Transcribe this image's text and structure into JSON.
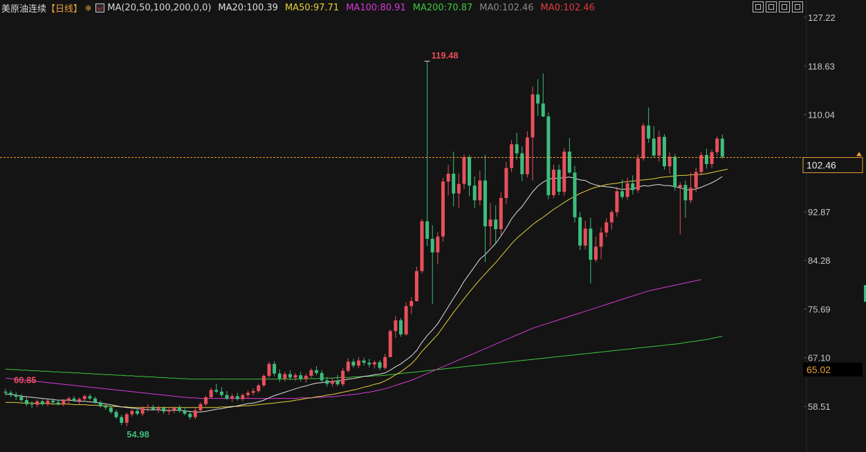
{
  "header": {
    "title": "美原油连续",
    "period": "【日线】",
    "settings_icon": "crosshair-settings-icon",
    "ma_icon": "indicator-settings-icon",
    "ma_param": "MA(20,50,100,200,0,0)",
    "ma_values": [
      {
        "label": "MA20:100.39",
        "color": "#e0e0e0"
      },
      {
        "label": "MA50:97.71",
        "color": "#e6d23c"
      },
      {
        "label": "MA100:80.91",
        "color": "#d83ad8"
      },
      {
        "label": "MA200:70.87",
        "color": "#3cc83c"
      },
      {
        "label": "MA0:102.46",
        "color": "#8a8a8a"
      },
      {
        "label": "MA0:102.46",
        "color": "#e23c3c"
      }
    ]
  },
  "toolbar": {
    "icons": [
      "layout-grid-icon",
      "layout-split-icon",
      "layout-panel-icon",
      "play-icon"
    ]
  },
  "colors": {
    "background": "#141414",
    "up": "#e8505b",
    "down": "#3dbd7d",
    "ma20": "#e0e0e0",
    "ma50": "#e6d23c",
    "ma100": "#d83ad8",
    "ma200": "#3cc83c",
    "axis_text": "#c8c8c8",
    "last_price_line": "#f0a030"
  },
  "chart_data": {
    "type": "candlestick",
    "y_axis": {
      "side": "right",
      "ticks": [
        "127.22",
        "118.63",
        "110.04",
        "92.87",
        "84.28",
        "75.69",
        "67.10",
        "58.51"
      ],
      "range": [
        52.0,
        127.22
      ]
    },
    "annotations": {
      "high": "119.48",
      "low": "54.98",
      "left_price": "60.85"
    },
    "current_price": {
      "value": 102.46,
      "label": "102.46"
    },
    "marker_price": {
      "value": 65.02,
      "label": "65.02"
    },
    "candles": [
      [
        61.1,
        61.6,
        60.4,
        60.9
      ],
      [
        60.9,
        61.3,
        60.1,
        60.5
      ],
      [
        60.5,
        61.0,
        59.6,
        60.2
      ],
      [
        60.2,
        60.7,
        59.3,
        59.6
      ],
      [
        59.6,
        60.1,
        58.5,
        58.9
      ],
      [
        58.9,
        59.4,
        58.2,
        58.8
      ],
      [
        58.8,
        59.7,
        58.4,
        59.4
      ],
      [
        59.4,
        59.8,
        58.6,
        58.9
      ],
      [
        58.9,
        59.7,
        58.5,
        59.5
      ],
      [
        59.5,
        59.9,
        58.8,
        59.2
      ],
      [
        59.2,
        59.6,
        58.6,
        58.9
      ],
      [
        58.9,
        59.8,
        58.5,
        59.6
      ],
      [
        59.6,
        60.2,
        59.0,
        59.9
      ],
      [
        59.9,
        60.3,
        59.3,
        59.5
      ],
      [
        59.5,
        60.1,
        58.9,
        59.8
      ],
      [
        59.8,
        60.6,
        59.5,
        60.3
      ],
      [
        60.3,
        60.7,
        59.6,
        59.9
      ],
      [
        59.9,
        60.2,
        59.0,
        59.2
      ],
      [
        59.2,
        59.5,
        58.3,
        58.6
      ],
      [
        58.6,
        59.1,
        57.9,
        58.3
      ],
      [
        58.3,
        58.6,
        57.2,
        57.5
      ],
      [
        57.5,
        57.9,
        56.3,
        56.6
      ],
      [
        56.6,
        57.0,
        55.2,
        55.6
      ],
      [
        55.6,
        57.4,
        54.98,
        57.1
      ],
      [
        57.1,
        58.0,
        56.7,
        57.7
      ],
      [
        57.7,
        58.2,
        56.9,
        57.2
      ],
      [
        57.2,
        58.5,
        56.8,
        58.2
      ],
      [
        58.2,
        58.9,
        57.6,
        58.4
      ],
      [
        58.4,
        58.8,
        57.7,
        58.0
      ],
      [
        58.0,
        58.6,
        57.3,
        58.2
      ],
      [
        58.2,
        58.5,
        57.2,
        57.6
      ],
      [
        57.6,
        58.2,
        57.0,
        57.9
      ],
      [
        57.9,
        58.5,
        57.3,
        58.3
      ],
      [
        58.3,
        58.7,
        57.4,
        57.7
      ],
      [
        57.7,
        58.3,
        56.9,
        57.2
      ],
      [
        57.2,
        57.6,
        56.2,
        56.6
      ],
      [
        56.6,
        58.2,
        56.2,
        57.8
      ],
      [
        57.8,
        59.2,
        57.5,
        58.9
      ],
      [
        58.9,
        60.4,
        58.6,
        60.1
      ],
      [
        60.1,
        61.8,
        59.9,
        61.4
      ],
      [
        61.4,
        62.5,
        60.8,
        61.1
      ],
      [
        61.1,
        61.9,
        60.1,
        60.5
      ],
      [
        60.5,
        61.2,
        59.6,
        59.9
      ],
      [
        59.9,
        60.7,
        59.3,
        60.3
      ],
      [
        60.3,
        60.9,
        59.5,
        59.8
      ],
      [
        59.8,
        60.8,
        59.4,
        60.5
      ],
      [
        60.5,
        61.3,
        60.0,
        60.9
      ],
      [
        60.9,
        61.7,
        60.4,
        61.2
      ],
      [
        61.2,
        62.5,
        60.9,
        62.2
      ],
      [
        62.2,
        64.2,
        61.9,
        63.9
      ],
      [
        63.9,
        66.4,
        63.5,
        66.0
      ],
      [
        66.0,
        66.5,
        63.8,
        64.3
      ],
      [
        64.3,
        65.0,
        62.8,
        63.4
      ],
      [
        63.4,
        64.6,
        62.9,
        64.2
      ],
      [
        64.2,
        64.9,
        63.1,
        63.6
      ],
      [
        63.6,
        64.4,
        63.0,
        64.0
      ],
      [
        64.0,
        64.6,
        62.9,
        63.3
      ],
      [
        63.3,
        64.3,
        62.7,
        63.9
      ],
      [
        63.9,
        65.2,
        63.6,
        64.9
      ],
      [
        64.9,
        65.6,
        64.0,
        64.4
      ],
      [
        64.4,
        64.9,
        62.7,
        63.1
      ],
      [
        63.1,
        63.7,
        62.0,
        62.5
      ],
      [
        62.5,
        63.4,
        62.0,
        63.0
      ],
      [
        63.0,
        64.1,
        62.1,
        62.4
      ],
      [
        62.4,
        65.3,
        62.0,
        64.8
      ],
      [
        64.8,
        67.0,
        64.5,
        66.4
      ],
      [
        66.4,
        66.9,
        65.3,
        65.7
      ],
      [
        65.7,
        67.2,
        65.2,
        66.6
      ],
      [
        66.6,
        67.1,
        65.7,
        66.2
      ],
      [
        66.2,
        66.9,
        65.4,
        65.9
      ],
      [
        65.9,
        66.6,
        65.2,
        66.3
      ],
      [
        66.3,
        66.7,
        64.9,
        65.3
      ],
      [
        65.3,
        67.8,
        65.0,
        67.2
      ],
      [
        67.2,
        72.1,
        69.1,
        71.8
      ],
      [
        71.8,
        74.5,
        70.6,
        73.7
      ],
      [
        73.7,
        74.1,
        70.8,
        71.2
      ],
      [
        71.2,
        76.9,
        71.0,
        76.2
      ],
      [
        76.2,
        77.8,
        74.8,
        77.1
      ],
      [
        77.1,
        83.2,
        77.0,
        82.4
      ],
      [
        82.4,
        91.6,
        82.0,
        91.2
      ],
      [
        91.2,
        119.48,
        86.8,
        88.1
      ],
      [
        88.1,
        90.5,
        76.6,
        85.7
      ],
      [
        85.7,
        89.3,
        83.6,
        88.5
      ],
      [
        88.5,
        98.9,
        87.6,
        98.2
      ],
      [
        98.2,
        101.2,
        95.7,
        99.6
      ],
      [
        99.6,
        103.5,
        93.8,
        96.1
      ],
      [
        96.1,
        99.6,
        93.6,
        97.8
      ],
      [
        97.8,
        103.0,
        96.9,
        102.5
      ],
      [
        102.5,
        102.9,
        95.6,
        97.5
      ],
      [
        97.5,
        99.1,
        93.5,
        94.9
      ],
      [
        94.9,
        100.1,
        94.0,
        98.4
      ],
      [
        98.4,
        102.9,
        84.0,
        90.3
      ],
      [
        90.3,
        94.4,
        86.8,
        91.5
      ],
      [
        91.5,
        94.0,
        87.3,
        89.8
      ],
      [
        89.8,
        96.3,
        88.8,
        95.3
      ],
      [
        95.3,
        101.7,
        94.2,
        100.6
      ],
      [
        100.6,
        105.5,
        99.9,
        104.8
      ],
      [
        104.8,
        106.8,
        102.1,
        103.2
      ],
      [
        103.2,
        104.4,
        98.3,
        99.5
      ],
      [
        99.5,
        107.1,
        98.9,
        106.0
      ],
      [
        106.0,
        115.0,
        98.4,
        113.6
      ],
      [
        113.6,
        116.3,
        109.8,
        112.0
      ],
      [
        112.0,
        117.3,
        109.6,
        109.7
      ],
      [
        109.7,
        110.4,
        95.1,
        95.8
      ],
      [
        95.8,
        101.2,
        95.3,
        100.3
      ],
      [
        100.3,
        101.2,
        95.8,
        96.4
      ],
      [
        96.4,
        104.1,
        95.7,
        103.5
      ],
      [
        103.5,
        105.9,
        99.6,
        99.8
      ],
      [
        99.8,
        101.0,
        91.0,
        91.9
      ],
      [
        91.9,
        92.8,
        86.1,
        86.9
      ],
      [
        86.9,
        91.3,
        86.2,
        89.9
      ],
      [
        89.9,
        91.8,
        80.2,
        84.4
      ],
      [
        84.4,
        88.5,
        84.0,
        86.7
      ],
      [
        86.7,
        90.1,
        84.5,
        89.2
      ],
      [
        89.2,
        91.7,
        88.4,
        91.0
      ],
      [
        91.0,
        93.2,
        89.7,
        92.8
      ],
      [
        92.8,
        97.3,
        92.0,
        96.5
      ],
      [
        96.5,
        98.6,
        95.1,
        95.5
      ],
      [
        95.5,
        98.9,
        95.0,
        97.9
      ],
      [
        97.9,
        99.3,
        95.9,
        96.7
      ],
      [
        96.7,
        103.0,
        96.2,
        102.3
      ],
      [
        102.3,
        108.5,
        101.9,
        108.1
      ],
      [
        108.1,
        111.3,
        105.1,
        105.8
      ],
      [
        105.8,
        108.0,
        102.5,
        102.8
      ],
      [
        102.8,
        107.2,
        101.7,
        106.1
      ],
      [
        106.1,
        106.6,
        100.3,
        100.9
      ],
      [
        100.9,
        103.4,
        99.6,
        102.6
      ],
      [
        102.6,
        103.1,
        96.6,
        97.2
      ],
      [
        97.2,
        98.1,
        88.9,
        97.6
      ],
      [
        97.6,
        98.4,
        91.8,
        94.9
      ],
      [
        94.9,
        99.8,
        94.4,
        97.1
      ],
      [
        97.1,
        100.7,
        96.3,
        99.9
      ],
      [
        99.9,
        103.5,
        99.3,
        102.9
      ],
      [
        102.9,
        104.0,
        100.5,
        101.3
      ],
      [
        101.3,
        103.9,
        100.6,
        103.4
      ],
      [
        103.4,
        106.2,
        102.8,
        105.8
      ],
      [
        105.8,
        106.5,
        102.2,
        102.6
      ]
    ],
    "ma20": [
      60.7,
      60.6,
      60.5,
      60.3,
      60.2,
      60.1,
      60.0,
      59.9,
      59.8,
      59.7,
      59.6,
      59.6,
      59.6,
      59.5,
      59.4,
      59.4,
      59.3,
      59.2,
      59.1,
      58.9,
      58.8,
      58.6,
      58.4,
      58.3,
      58.2,
      58.1,
      58.0,
      57.9,
      57.9,
      57.9,
      57.8,
      57.8,
      57.8,
      57.8,
      57.7,
      57.6,
      57.5,
      57.5,
      57.6,
      57.8,
      58.0,
      58.1,
      58.3,
      58.4,
      58.6,
      58.8,
      59.0,
      59.1,
      59.3,
      59.6,
      60.0,
      60.4,
      60.7,
      61.0,
      61.3,
      61.6,
      61.9,
      62.1,
      62.4,
      62.6,
      62.7,
      62.8,
      62.9,
      63.0,
      63.1,
      63.3,
      63.4,
      63.6,
      63.8,
      63.9,
      64.1,
      64.2,
      64.4,
      64.9,
      65.5,
      66.0,
      66.7,
      67.4,
      68.4,
      69.8,
      71.0,
      72.0,
      73.1,
      74.6,
      76.1,
      77.6,
      79.0,
      80.6,
      81.9,
      83.2,
      84.5,
      85.3,
      86.3,
      87.3,
      88.6,
      90.0,
      91.6,
      92.8,
      93.8,
      95.1,
      96.4,
      97.4,
      98.1,
      98.6,
      98.8,
      98.8,
      98.9,
      99.0,
      98.8,
      98.5,
      98.4,
      97.9,
      97.6,
      97.4,
      97.3,
      97.2,
      97.0,
      96.8,
      96.9,
      96.9,
      97.2,
      97.5,
      97.4,
      97.6,
      97.7,
      97.5,
      97.5,
      97.3,
      97.1,
      96.8,
      96.7,
      96.9,
      97.2,
      97.6,
      98.0,
      98.5,
      99.1
    ],
    "ma50": [
      59.2,
      59.2,
      59.2,
      59.1,
      59.1,
      59.1,
      59.0,
      59.0,
      59.0,
      58.9,
      58.9,
      58.9,
      58.9,
      58.8,
      58.8,
      58.8,
      58.7,
      58.7,
      58.6,
      58.6,
      58.5,
      58.5,
      58.4,
      58.4,
      58.3,
      58.3,
      58.3,
      58.3,
      58.3,
      58.3,
      58.3,
      58.3,
      58.3,
      58.3,
      58.3,
      58.3,
      58.3,
      58.3,
      58.3,
      58.3,
      58.3,
      58.4,
      58.4,
      58.5,
      58.5,
      58.6,
      58.6,
      58.7,
      58.8,
      58.9,
      59.0,
      59.1,
      59.2,
      59.3,
      59.4,
      59.6,
      59.7,
      59.9,
      60.0,
      60.2,
      60.3,
      60.5,
      60.6,
      60.8,
      61.0,
      61.2,
      61.4,
      61.6,
      61.9,
      62.1,
      62.4,
      62.6,
      63.0,
      63.5,
      64.1,
      64.6,
      65.3,
      66.0,
      67.0,
      68.2,
      69.2,
      70.2,
      71.2,
      72.5,
      73.8,
      75.1,
      76.3,
      77.5,
      78.7,
      79.8,
      80.9,
      81.9,
      82.9,
      83.9,
      85.0,
      86.1,
      87.2,
      88.2,
      89.0,
      89.8,
      90.6,
      91.3,
      91.9,
      92.6,
      93.3,
      93.9,
      94.5,
      95.1,
      95.6,
      96.1,
      96.5,
      96.9,
      97.2,
      97.4,
      97.7,
      97.8,
      97.9,
      98.1,
      98.2,
      98.3,
      98.4,
      98.5,
      98.6,
      98.7,
      98.9,
      99.0,
      99.1,
      99.2,
      99.3,
      99.3,
      99.4,
      99.4,
      99.5,
      99.6,
      99.8,
      100.0,
      100.2,
      100.4
    ],
    "ma100": [
      63.5,
      63.4,
      63.3,
      63.2,
      63.1,
      63.0,
      62.9,
      62.8,
      62.7,
      62.6,
      62.5,
      62.4,
      62.3,
      62.2,
      62.1,
      62.0,
      61.9,
      61.8,
      61.7,
      61.6,
      61.5,
      61.4,
      61.3,
      61.2,
      61.1,
      61.0,
      60.9,
      60.8,
      60.7,
      60.6,
      60.5,
      60.4,
      60.3,
      60.2,
      60.1,
      60.0,
      60.0,
      59.9,
      59.9,
      59.9,
      59.9,
      59.9,
      59.9,
      59.9,
      59.9,
      59.9,
      59.9,
      59.9,
      59.9,
      59.9,
      59.9,
      59.9,
      59.9,
      59.9,
      59.9,
      59.9,
      60.0,
      60.0,
      60.0,
      60.1,
      60.1,
      60.2,
      60.2,
      60.3,
      60.4,
      60.5,
      60.6,
      60.7,
      60.9,
      61.0,
      61.2,
      61.4,
      61.6,
      61.9,
      62.2,
      62.5,
      62.8,
      63.1,
      63.5,
      63.9,
      64.3,
      64.7,
      65.1,
      65.5,
      65.9,
      66.3,
      66.7,
      67.1,
      67.5,
      67.9,
      68.3,
      68.7,
      69.1,
      69.5,
      69.9,
      70.3,
      70.7,
      71.1,
      71.5,
      71.9,
      72.3,
      72.6,
      72.9,
      73.2,
      73.5,
      73.8,
      74.1,
      74.4,
      74.7,
      75.0,
      75.3,
      75.6,
      75.9,
      76.2,
      76.5,
      76.8,
      77.1,
      77.4,
      77.7,
      78.0,
      78.3,
      78.6,
      78.9,
      79.1,
      79.3,
      79.5,
      79.7,
      79.9,
      80.1,
      80.3,
      80.5,
      80.7,
      80.9
    ],
    "ma200": [
      65.1,
      65.0,
      65.0,
      64.9,
      64.9,
      64.8,
      64.8,
      64.7,
      64.7,
      64.6,
      64.6,
      64.5,
      64.5,
      64.4,
      64.4,
      64.3,
      64.3,
      64.2,
      64.2,
      64.1,
      64.1,
      64.0,
      64.0,
      63.9,
      63.9,
      63.8,
      63.8,
      63.7,
      63.7,
      63.6,
      63.6,
      63.5,
      63.5,
      63.4,
      63.4,
      63.3,
      63.3,
      63.3,
      63.3,
      63.3,
      63.3,
      63.3,
      63.3,
      63.3,
      63.3,
      63.3,
      63.3,
      63.3,
      63.3,
      63.3,
      63.3,
      63.3,
      63.3,
      63.3,
      63.3,
      63.3,
      63.4,
      63.4,
      63.4,
      63.4,
      63.5,
      63.5,
      63.5,
      63.6,
      63.6,
      63.6,
      63.7,
      63.7,
      63.8,
      63.8,
      63.9,
      63.9,
      64.0,
      64.1,
      64.2,
      64.3,
      64.4,
      64.5,
      64.6,
      64.7,
      64.8,
      64.9,
      65.0,
      65.1,
      65.2,
      65.3,
      65.4,
      65.5,
      65.6,
      65.7,
      65.8,
      65.9,
      66.0,
      66.1,
      66.2,
      66.3,
      66.4,
      66.5,
      66.6,
      66.7,
      66.8,
      66.9,
      67.0,
      67.1,
      67.2,
      67.3,
      67.4,
      67.5,
      67.6,
      67.7,
      67.8,
      67.9,
      68.0,
      68.1,
      68.2,
      68.3,
      68.4,
      68.5,
      68.6,
      68.7,
      68.8,
      68.9,
      69.0,
      69.1,
      69.2,
      69.3,
      69.4,
      69.5,
      69.6,
      69.8,
      69.9,
      70.0,
      70.2,
      70.3,
      70.5,
      70.7,
      70.87
    ]
  }
}
